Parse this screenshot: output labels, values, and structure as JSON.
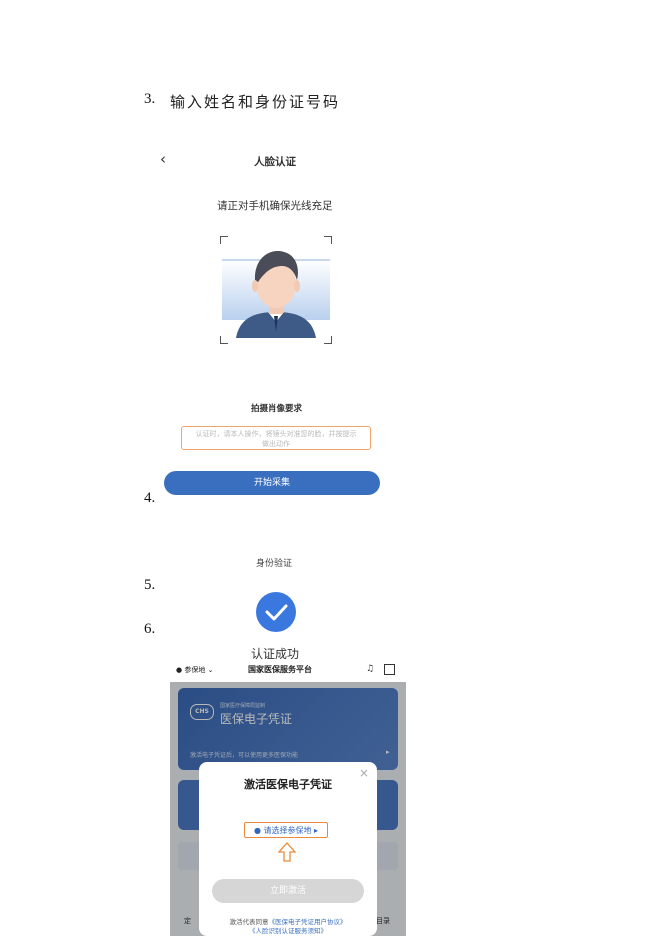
{
  "step3": {
    "number": "3.",
    "text": "输入姓名和身份证号码"
  },
  "step4": {
    "number": "4."
  },
  "step5": {
    "number": "5."
  },
  "step6": {
    "number": "6."
  },
  "face_auth": {
    "back_icon": "chevron-left-icon",
    "title": "人脸认证",
    "hint": "请正对手机确保光线充足",
    "requirements_title": "拍摄肖像要求",
    "requirements_text_line1": "认证时，请本人操作，将镜头对准您的脸，并按提示",
    "requirements_text_line2": "做出动作",
    "start_button": "开始采集",
    "accent_color": "#3a6fc0",
    "box_border_color": "#f0a36a"
  },
  "identity_verification": {
    "label": "身份验证",
    "check_icon": "check-circle-icon",
    "success_text": "认证成功",
    "accent_color": "#3a78e0"
  },
  "app": {
    "location_label": "参保地",
    "title": "国家医保服务平台",
    "bell_icon": "bell-icon",
    "scan_icon": "scan-icon",
    "card_org": "国家医疗保障局监制",
    "card_logo": "CHS",
    "card_title": "医保电子凭证",
    "card_hint": "激活电子凭证后，可以使用更多医保功能",
    "modal": {
      "title": "激活医保电子凭证",
      "close_icon": "close-icon",
      "region_button": "请选择参保地",
      "arrow_icon": "arrow-up-icon",
      "activate_button": "立即激活",
      "agreement_prefix": "激活代表同意",
      "agreement_link1": "《医保电子凭证用户协议》",
      "agreement_link2": "《人脸识别认证服务须知》"
    },
    "side_labels": {
      "left": "定",
      "right": "目录"
    }
  }
}
